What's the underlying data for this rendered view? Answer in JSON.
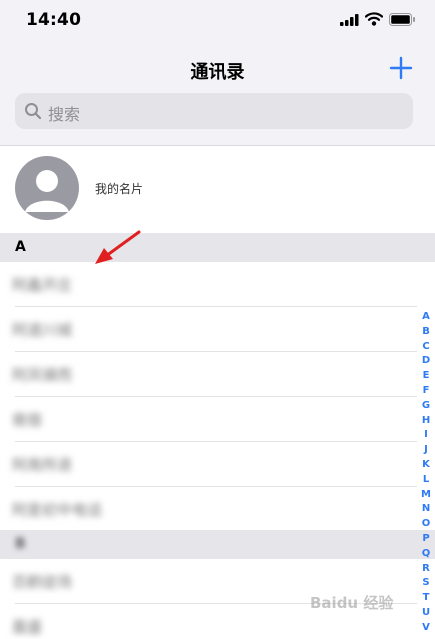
{
  "status": {
    "time": "14:40"
  },
  "nav": {
    "title": "通讯录",
    "add_icon": "plus-icon"
  },
  "search": {
    "placeholder": "搜索"
  },
  "my_card": {
    "label": "我的名片"
  },
  "sections": [
    {
      "letter": "A",
      "contacts": [
        "阿鑫开庄",
        "阿道川城",
        "阿凤镇而",
        "凿宿",
        "阿南所退",
        "阿是初中电话"
      ]
    },
    {
      "letter": "B",
      "contacts": [
        "百鹤徒场",
        "凰盛"
      ]
    }
  ],
  "index_letters": [
    "A",
    "B",
    "C",
    "D",
    "E",
    "F",
    "G",
    "H",
    "I",
    "J",
    "K",
    "L",
    "M",
    "N",
    "O",
    "P",
    "Q",
    "R",
    "S",
    "T",
    "U",
    "V"
  ],
  "colors": {
    "accent": "#2f7bf5",
    "arrow": "#e02020"
  },
  "watermark": "Baidu 经验"
}
